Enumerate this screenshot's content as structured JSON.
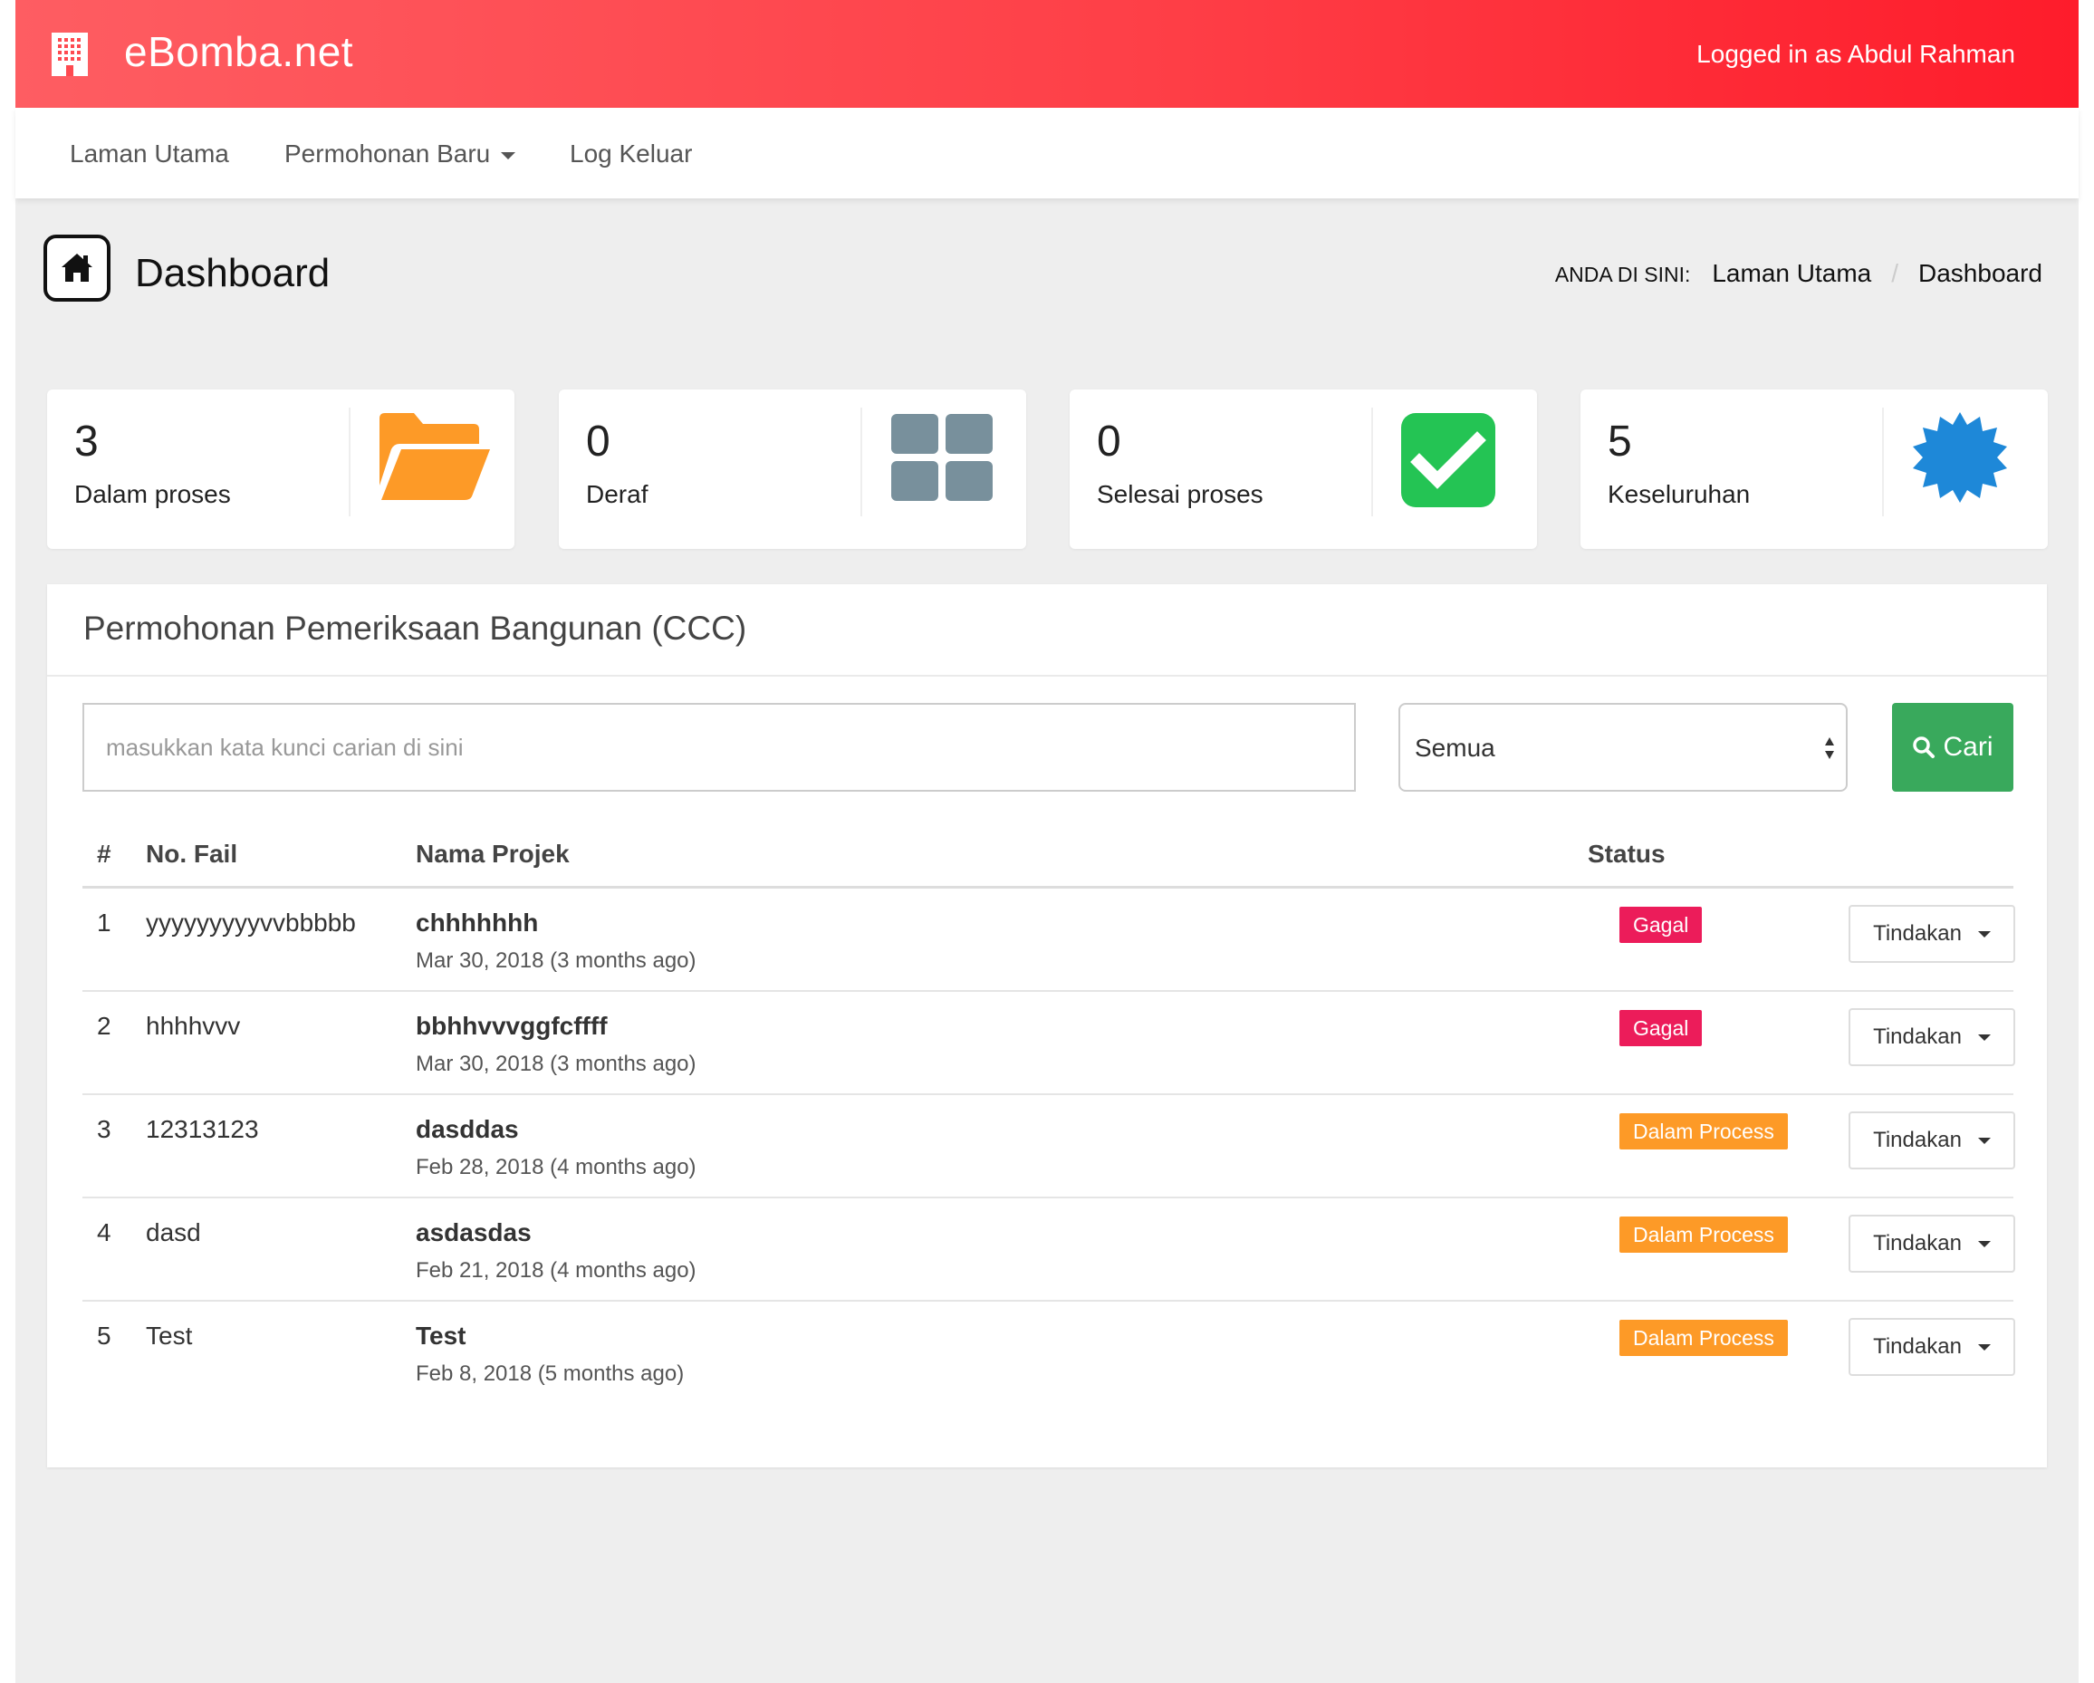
{
  "header": {
    "brand": "eBomba.net",
    "logged_in": "Logged in as Abdul Rahman",
    "logo_icon": "building-icon",
    "color": "#fe3f47"
  },
  "nav": {
    "items": [
      {
        "label": "Laman Utama"
      },
      {
        "label": "Permohonan Baru",
        "dropdown": true
      },
      {
        "label": "Log Keluar"
      }
    ]
  },
  "page": {
    "title": "Dashboard",
    "icon": "home-icon",
    "breadcrumb": {
      "prefix": "ANDA DI SINI:",
      "items": [
        "Laman Utama",
        "Dashboard"
      ]
    }
  },
  "stats": [
    {
      "value": "3",
      "label": "Dalam proses",
      "icon": "folder-open-icon",
      "color": "#fd9a27"
    },
    {
      "value": "0",
      "label": "Deraf",
      "icon": "grid-icon",
      "color": "#78909c"
    },
    {
      "value": "0",
      "label": "Selesai proses",
      "icon": "check-square-icon",
      "color": "#24c454"
    },
    {
      "value": "5",
      "label": "Keseluruhan",
      "icon": "badge-icon",
      "color": "#1e88d8"
    }
  ],
  "panel": {
    "title": "Permohonan Pemeriksaan Bangunan (CCC)",
    "search_placeholder": "masukkan kata kunci carian di sini",
    "filter_value": "Semua",
    "search_button": "Cari",
    "columns": [
      "#",
      "No. Fail",
      "Nama Projek",
      "Status"
    ],
    "action_label": "Tindakan",
    "rows": [
      {
        "idx": "1",
        "no_fail": "yyyyyyyyyvvbbbbb",
        "project": "chhhhhhh",
        "date": "Mar 30, 2018 (3 months ago)",
        "status": "Gagal",
        "status_type": "fail"
      },
      {
        "idx": "2",
        "no_fail": "hhhhvvv",
        "project": "bbhhvvvggfcffff",
        "date": "Mar 30, 2018 (3 months ago)",
        "status": "Gagal",
        "status_type": "fail"
      },
      {
        "idx": "3",
        "no_fail": "12313123",
        "project": "dasddas",
        "date": "Feb 28, 2018 (4 months ago)",
        "status": "Dalam Process",
        "status_type": "process"
      },
      {
        "idx": "4",
        "no_fail": "dasd",
        "project": "asdasdas",
        "date": "Feb 21, 2018 (4 months ago)",
        "status": "Dalam Process",
        "status_type": "process"
      },
      {
        "idx": "5",
        "no_fail": "Test",
        "project": "Test",
        "date": "Feb 8, 2018 (5 months ago)",
        "status": "Dalam Process",
        "status_type": "process"
      }
    ]
  }
}
